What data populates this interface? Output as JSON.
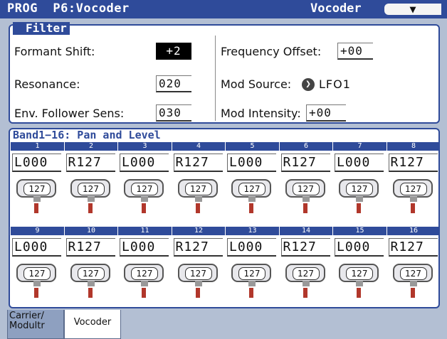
{
  "header": {
    "title": "PROG  P6:Vocoder",
    "page": "Vocoder",
    "menu_icon": "▼"
  },
  "filter": {
    "label": "Filter",
    "formant_shift": {
      "label": "Formant Shift:",
      "value": "+2"
    },
    "resonance": {
      "label": "Resonance:",
      "value": "020"
    },
    "env_sens": {
      "label": "Env. Follower Sens:",
      "value": "030"
    },
    "freq_offset": {
      "label": "Frequency Offset:",
      "value": "+00"
    },
    "mod_source": {
      "label": "Mod Source:",
      "value": "LFO1",
      "icon": "arrow-right-icon"
    },
    "mod_intensity": {
      "label": "Mod Intensity:",
      "value": "+00"
    }
  },
  "band": {
    "title": "Band1−16: Pan and Level",
    "row1": {
      "numbers": [
        "1",
        "2",
        "3",
        "4",
        "5",
        "6",
        "7",
        "8"
      ],
      "pans": [
        "L000",
        "R127",
        "L000",
        "R127",
        "L000",
        "R127",
        "L000",
        "R127"
      ],
      "levels": [
        "127",
        "127",
        "127",
        "127",
        "127",
        "127",
        "127",
        "127"
      ]
    },
    "row2": {
      "numbers": [
        "9",
        "10",
        "11",
        "12",
        "13",
        "14",
        "15",
        "16"
      ],
      "pans": [
        "L000",
        "R127",
        "L000",
        "R127",
        "L000",
        "R127",
        "L000",
        "R127"
      ],
      "levels": [
        "127",
        "127",
        "127",
        "127",
        "127",
        "127",
        "127",
        "127"
      ]
    }
  },
  "tabs": {
    "carrier_line1": "Carrier/",
    "carrier_line2": "Modultr",
    "vocoder": "Vocoder"
  }
}
